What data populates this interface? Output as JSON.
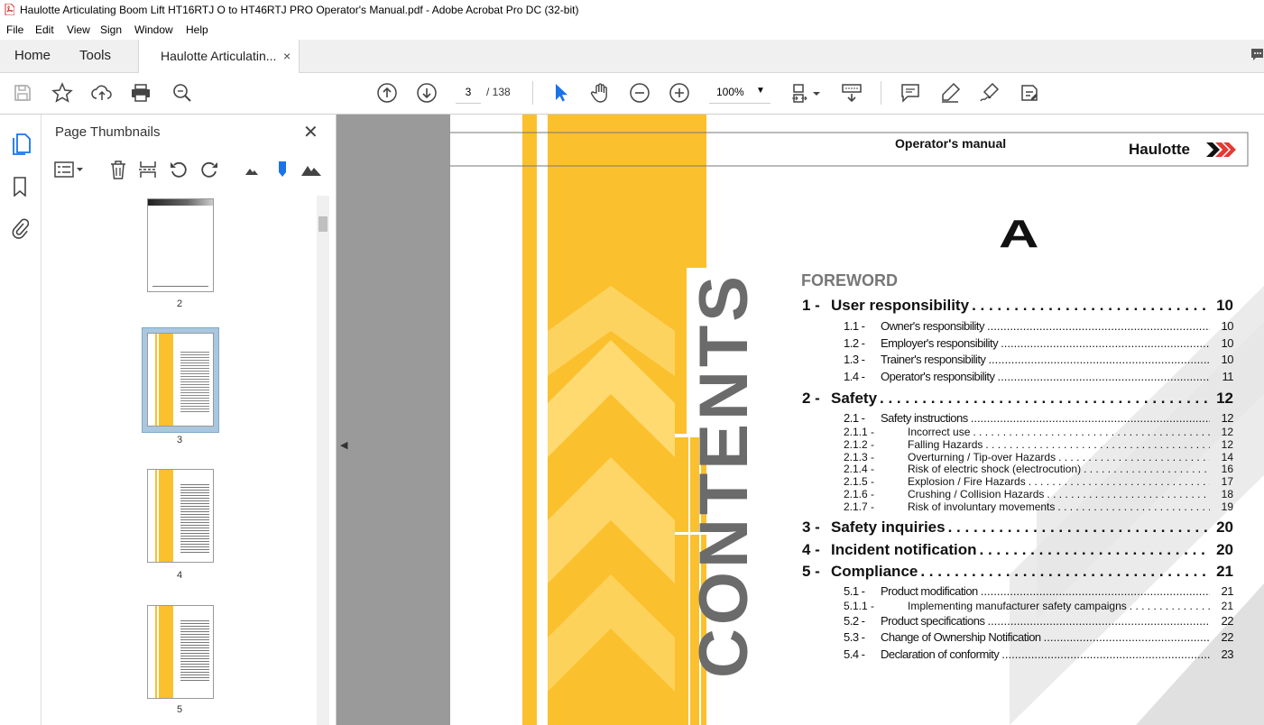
{
  "window": {
    "title": "Haulotte Articulating Boom Lift HT16RTJ O to HT46RTJ PRO Operator's Manual.pdf - Adobe Acrobat Pro DC (32-bit)"
  },
  "menu": [
    "File",
    "Edit",
    "View",
    "Sign",
    "Window",
    "Help"
  ],
  "tabs": {
    "home": "Home",
    "tools": "Tools",
    "document": "Haulotte Articulatin...",
    "close": "×"
  },
  "toolbar": {
    "current_page": "3",
    "page_total": "/ 138",
    "zoom": "100%",
    "zoom_caret": "▼"
  },
  "thumbnails_panel": {
    "title": "Page Thumbnails",
    "close": "✕",
    "pages": [
      {
        "label": "2"
      },
      {
        "label": "3"
      },
      {
        "label": "4"
      },
      {
        "label": "5"
      }
    ],
    "selected_page": "3"
  },
  "document": {
    "header_text": "Operator's manual",
    "brand": "Haulotte",
    "section_letter": "A",
    "foreword": "FOREWORD",
    "side_text": "CONTENTS",
    "toc": [
      {
        "level": 1,
        "num": "1 -",
        "title": "User responsibility",
        "page": "10"
      },
      {
        "level": 2,
        "num": "1.1 -",
        "title": "Owner's responsibility",
        "page": "10"
      },
      {
        "level": 2,
        "num": "1.2 -",
        "title": "Employer's responsibility",
        "page": "10"
      },
      {
        "level": 2,
        "num": "1.3 -",
        "title": "Trainer's responsibility",
        "page": "10"
      },
      {
        "level": 2,
        "num": "1.4 -",
        "title": "Operator's responsibility",
        "page": "11"
      },
      {
        "level": 1,
        "num": "2 -",
        "title": "Safety",
        "page": "12"
      },
      {
        "level": 2,
        "num": "2.1 -",
        "title": "Safety instructions",
        "page": "12"
      },
      {
        "level": 3,
        "num": "2.1.1 -",
        "title": "Incorrect use",
        "page": "12"
      },
      {
        "level": 3,
        "num": "2.1.2 -",
        "title": "Falling Hazards",
        "page": "12"
      },
      {
        "level": 3,
        "num": "2.1.3 -",
        "title": "Overturning / Tip-over Hazards",
        "page": "14"
      },
      {
        "level": 3,
        "num": "2.1.4 -",
        "title": "Risk of electric shock (electrocution)",
        "page": "16"
      },
      {
        "level": 3,
        "num": "2.1.5 -",
        "title": "Explosion / Fire Hazards",
        "page": "17"
      },
      {
        "level": 3,
        "num": "2.1.6 -",
        "title": "Crushing / Collision Hazards",
        "page": "18"
      },
      {
        "level": 3,
        "num": "2.1.7 -",
        "title": "Risk of involuntary movements",
        "page": "19"
      },
      {
        "level": 1,
        "num": "3 -",
        "title": "Safety inquiries",
        "page": "20"
      },
      {
        "level": 1,
        "num": "4 -",
        "title": "Incident notification",
        "page": "20"
      },
      {
        "level": 1,
        "num": "5 -",
        "title": "Compliance",
        "page": "21"
      },
      {
        "level": 2,
        "num": "5.1 -",
        "title": "Product modification",
        "page": "21"
      },
      {
        "level": 3,
        "num": "5.1.1 -",
        "title": "Implementing manufacturer safety campaigns",
        "page": "21"
      },
      {
        "level": 2,
        "num": "5.2 -",
        "title": "Product specifications",
        "page": "22"
      },
      {
        "level": 2,
        "num": "5.3 -",
        "title": "Change of Ownership Notification",
        "page": "22"
      },
      {
        "level": 2,
        "num": "5.4 -",
        "title": "Declaration of conformity",
        "page": "23"
      }
    ]
  },
  "colors": {
    "accent_yellow": "#fbc02d",
    "brand_red": "#e53935",
    "tool_blue": "#1a73e8",
    "selection_blue": "#a9c8e0"
  }
}
